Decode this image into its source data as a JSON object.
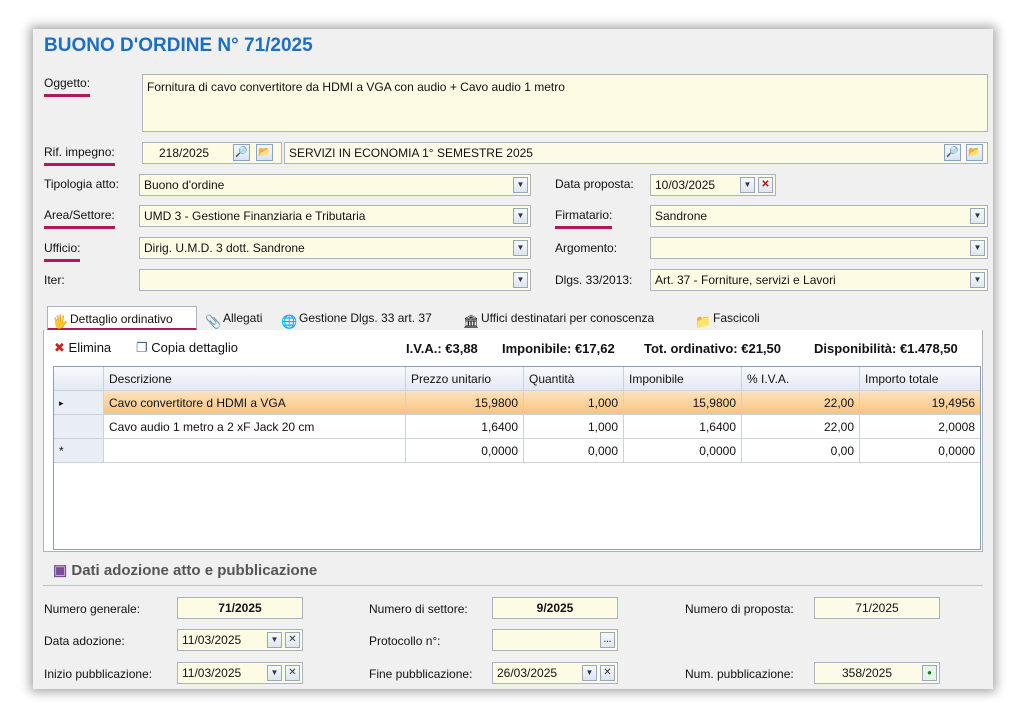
{
  "header": {
    "title": "BUONO D'ORDINE N° 71/2025"
  },
  "form": {
    "oggetto_label": "Oggetto:",
    "oggetto_value": "Fornitura di cavo convertitore da HDMI a VGA con audio + Cavo audio 1 metro",
    "rif_impegno_label": "Rif. impegno:",
    "rif_impegno_value": "218/2025",
    "rif_impegno_desc": "SERVIZI IN ECONOMIA 1° SEMESTRE 2025",
    "tipologia_label": "Tipologia atto:",
    "tipologia_value": "Buono d'ordine",
    "data_proposta_label": "Data proposta:",
    "data_proposta_value": "10/03/2025",
    "area_label": "Area/Settore:",
    "area_value": "UMD 3 - Gestione Finanziaria e Tributaria",
    "firmatario_label": "Firmatario:",
    "firmatario_value": "Sandrone",
    "ufficio_label": "Ufficio:",
    "ufficio_value": "Dirig. U.M.D. 3 dott. Sandrone",
    "argomento_label": "Argomento:",
    "argomento_value": "",
    "iter_label": "Iter:",
    "iter_value": "",
    "dlgs_label": "Dlgs. 33/2013:",
    "dlgs_value": "Art. 37 - Forniture, servizi e Lavori"
  },
  "tabs": [
    {
      "label": "Dettaglio ordinativo",
      "icon": "hand-coins-icon"
    },
    {
      "label": "Allegati",
      "icon": "paperclip-icon"
    },
    {
      "label": "Gestione Dlgs. 33 art. 37",
      "icon": "globe-icon"
    },
    {
      "label": "Uffici destinatari per conoscenza",
      "icon": "bank-icon"
    },
    {
      "label": "Fascicoli",
      "icon": "folder-icon"
    }
  ],
  "toolbar": {
    "elimina": "Elimina",
    "copia": "Copia dettaglio",
    "iva": "I.V.A.: €3,88",
    "imponibile": "Imponibile: €17,62",
    "tot_ordinativo": "Tot. ordinativo: €21,50",
    "disponibilita": "Disponibilità: €1.478,50"
  },
  "grid": {
    "columns": [
      "Descrizione",
      "Prezzo unitario",
      "Quantità",
      "Imponibile",
      "% I.V.A.",
      "Importo totale"
    ],
    "rows": [
      [
        "Cavo convertitore d HDMI a VGA",
        "15,9800",
        "1,000",
        "15,9800",
        "22,00",
        "19,4956"
      ],
      [
        "Cavo audio 1 metro a 2 xF Jack 20 cm",
        "1,6400",
        "1,000",
        "1,6400",
        "22,00",
        "2,0008"
      ],
      [
        "",
        "0,0000",
        "0,000",
        "0,0000",
        "0,00",
        "0,0000"
      ]
    ],
    "new_row_marker": "*",
    "current_row_marker": "▸"
  },
  "adozione": {
    "title": "Dati adozione atto e pubblicazione",
    "numero_generale_label": "Numero generale:",
    "numero_generale_value": "71/2025",
    "numero_settore_label": "Numero di settore:",
    "numero_settore_value": "9/2025",
    "numero_proposta_label": "Numero di proposta:",
    "numero_proposta_value": "71/2025",
    "data_adozione_label": "Data adozione:",
    "data_adozione_value": "11/03/2025",
    "protocollo_label": "Protocollo n°:",
    "protocollo_value": "",
    "inizio_pub_label": "Inizio pubblicazione:",
    "inizio_pub_value": "11/03/2025",
    "fine_pub_label": "Fine pubblicazione:",
    "fine_pub_value": "26/03/2025",
    "num_pub_label": "Num. pubblicazione:",
    "num_pub_value": "358/2025"
  },
  "colors": {
    "title": "#1c6fc6",
    "underline": "#b0195b",
    "field_bg": "#fefbe5",
    "selected_row": "#f8c47f"
  }
}
